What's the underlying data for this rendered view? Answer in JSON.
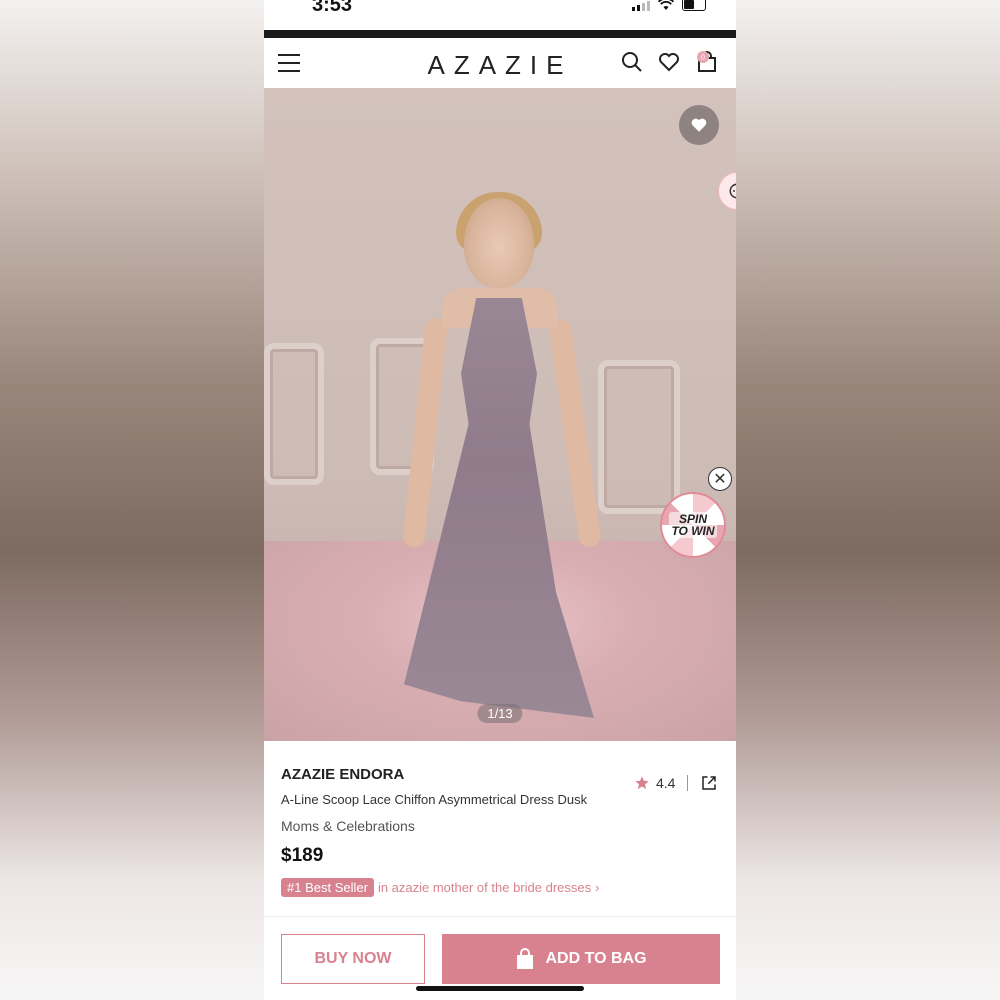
{
  "status_bar": {
    "time": "3:53"
  },
  "header": {
    "logo": "AZAZIE",
    "cart_count": "0"
  },
  "hero": {
    "image_counter": "1/13",
    "spin_line1": "SPIN",
    "spin_line2": "TO WIN"
  },
  "product": {
    "brand": "AZAZIE ENDORA",
    "description": "A-Line Scoop Lace Chiffon Asymmetrical Dress Dusk",
    "category": "Moms & Celebrations",
    "price": "$189",
    "rating": "4.4",
    "best_seller_badge": "#1 Best Seller",
    "best_seller_text": "in azazie mother of the bride dresses"
  },
  "actions": {
    "buy_now": "BUY NOW",
    "add_to_bag": "ADD TO BAG"
  },
  "colors": {
    "accent": "#d9828f",
    "dress": "#9a8795"
  }
}
